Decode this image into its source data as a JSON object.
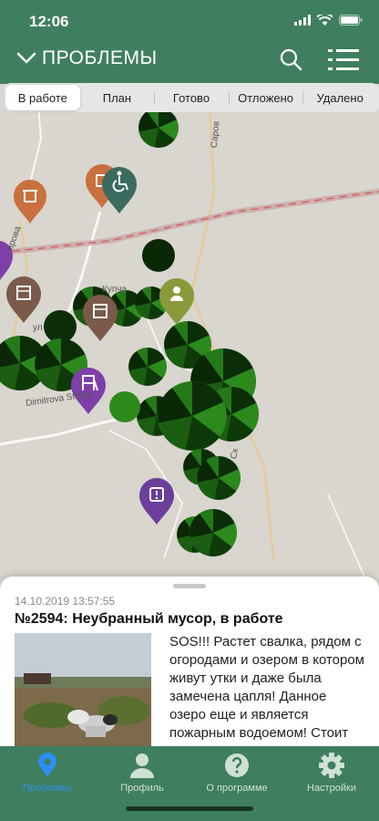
{
  "status_bar": {
    "time": "12:06"
  },
  "header": {
    "title": "ПРОБЛЕМЫ",
    "chevron_icon": "chevron-down-icon",
    "search_icon": "search-icon",
    "list_icon": "list-icon"
  },
  "tabs": [
    {
      "label": "В работе",
      "active": true
    },
    {
      "label": "План",
      "active": false
    },
    {
      "label": "Готово",
      "active": false
    },
    {
      "label": "Отложено",
      "active": false
    },
    {
      "label": "Удалено",
      "active": false
    }
  ],
  "map": {
    "street_labels": [
      "Dimitrova Street",
      "ул",
      "Купча",
      "ирова",
      "Саров",
      "Ск"
    ],
    "markers": [
      "trash-marker-icon",
      "trash-marker-icon",
      "wheelchair-marker-icon",
      "building-marker-icon",
      "building-marker-icon",
      "person-marker-icon",
      "playground-marker-icon",
      "warning-marker-icon"
    ]
  },
  "problem_card": {
    "date": "14.10.2019 13:57:55",
    "title": "№2594: Неубранный мусор, в работе",
    "description": "SOS!!! Растет свалка, рядом с огородами и озером в котором живут утки и даже была замечена цапля! Данное озеро еще и является пожарным водоемом! Стоит вонь, мусор ветром разносит"
  },
  "tab_bar": [
    {
      "label": "Проблемы",
      "icon": "map-pin-icon",
      "active": true
    },
    {
      "label": "Профиль",
      "icon": "profile-icon",
      "active": false
    },
    {
      "label": "О программе",
      "icon": "help-icon",
      "active": false
    },
    {
      "label": "Настройки",
      "icon": "settings-gear-icon",
      "active": false
    }
  ],
  "colors": {
    "brand_green": "#3f7f5f",
    "active_tab_blue": "#2d8ff0",
    "cluster_green": "#1f6e12",
    "cluster_dark": "#0a2a06"
  }
}
